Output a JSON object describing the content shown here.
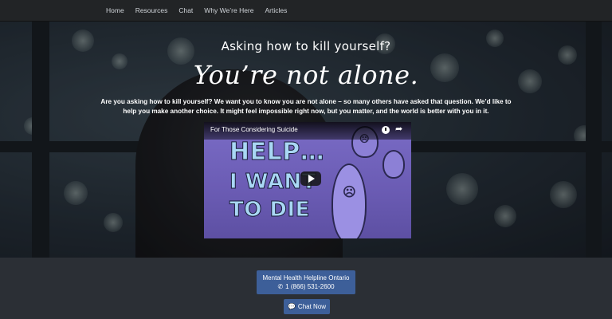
{
  "nav": {
    "items": [
      {
        "label": "Home"
      },
      {
        "label": "Resources"
      },
      {
        "label": "Chat"
      },
      {
        "label": "Why We’re Here"
      },
      {
        "label": "Articles"
      }
    ]
  },
  "hero": {
    "subtitle": "Asking how to kill yourself?",
    "title": "You’re not alone.",
    "text": "Are you asking how to kill yourself? We want you to know you are not alone – so many others have asked that question. We’d like to help you make another choice. It might feel impossible right now, but you matter, and the world is better with you in it."
  },
  "video": {
    "title": "For Those Considering Suicide",
    "thumbnail_text": {
      "line1": "HELP…",
      "line2": "I WANT",
      "line3": "TO DIE"
    },
    "icons": [
      "clock-icon",
      "share-icon",
      "play-icon"
    ]
  },
  "cta": {
    "helpline_label": "Mental Health Helpline Ontario",
    "helpline_phone": "1 (866) 531-2600",
    "chat_label": "Chat Now",
    "button_color": "#3d5f99"
  }
}
